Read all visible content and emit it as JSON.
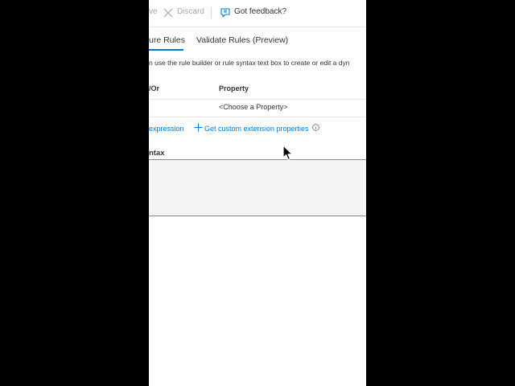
{
  "toolbar": {
    "save_label": "ve",
    "discard_label": "Discard",
    "feedback_label": "Got feedback?",
    "disabled_color": "#a6a6a6",
    "accent_color": "#0078d4"
  },
  "tabs": [
    {
      "label": "ure Rules",
      "active": true
    },
    {
      "label": "Validate Rules (Preview)",
      "active": false
    }
  ],
  "description": "n use the rule builder or rule syntax text box to create or edit a dyn",
  "rule_table": {
    "columns": [
      "/Or",
      "Property"
    ],
    "rows": [
      {
        "and_or": "",
        "property": "<Choose a Property>"
      }
    ]
  },
  "links": {
    "add_expression": "expression",
    "custom_extension": "Get custom extension properties"
  },
  "syntax": {
    "label": "ntax",
    "value": ""
  },
  "icons": [
    "discard-icon",
    "feedback-icon",
    "plus-icon",
    "info-icon",
    "mouse-cursor-icon"
  ]
}
